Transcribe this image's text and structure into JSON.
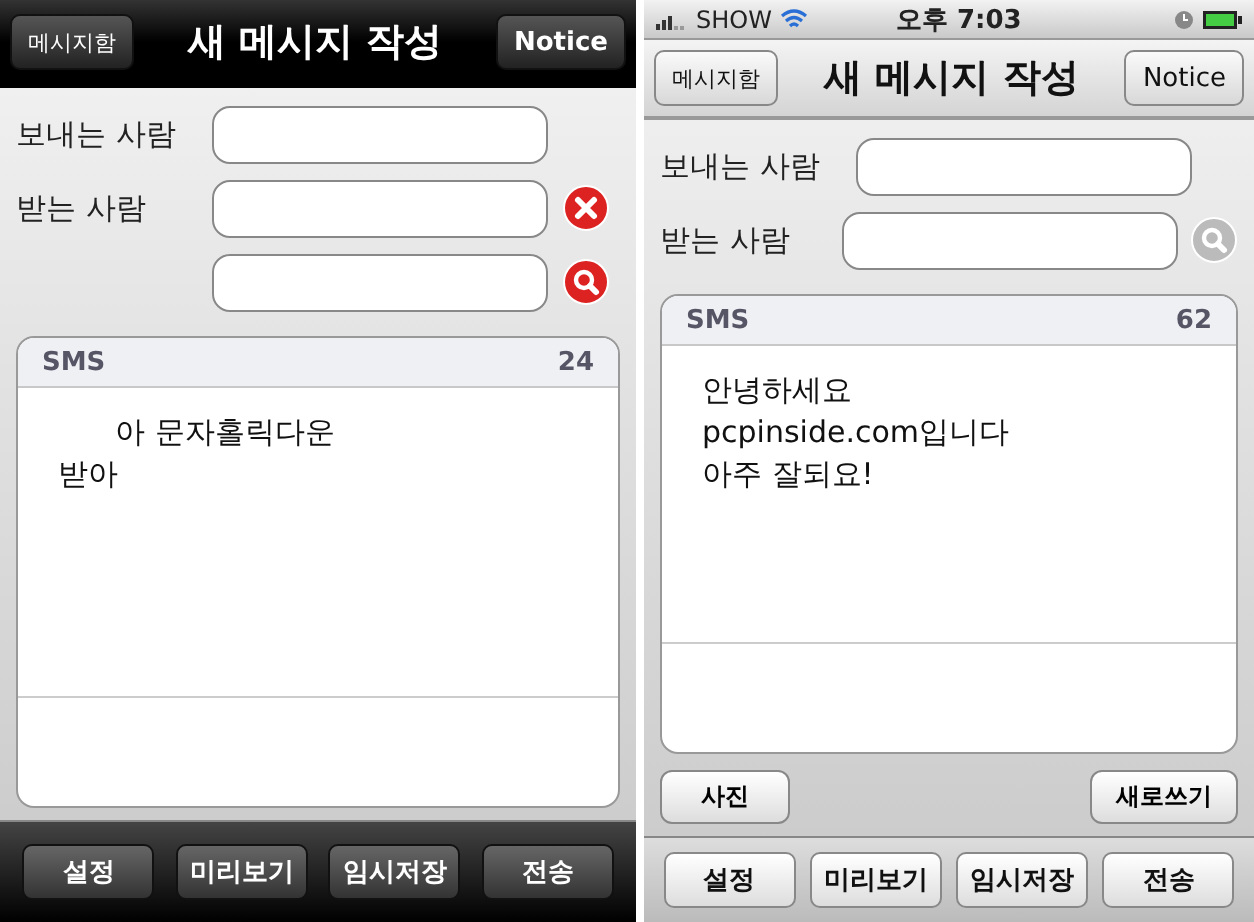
{
  "screens": [
    {
      "kind": "dark",
      "nav": {
        "back": "메시지함",
        "title": "새 메시지 작성",
        "action": "Notice"
      },
      "sender_label": "보내는 사람",
      "recipient_label": "받는 사람",
      "recipients": [
        {
          "kind": "delete",
          "active": true
        },
        {
          "kind": "search",
          "active": true
        }
      ],
      "message": {
        "type": "SMS",
        "count": "24",
        "text": "      아 문자홀릭다운\n받아"
      },
      "toolbar": [
        "설정",
        "미리보기",
        "임시저장",
        "전송"
      ]
    },
    {
      "kind": "light",
      "status_bar": {
        "carrier": "SHOW",
        "time": "오후 7:03"
      },
      "nav": {
        "back": "메시지함",
        "title": "새 메시지 작성",
        "action": "Notice"
      },
      "sender_label": "보내는 사람",
      "recipient_label": "받는 사람",
      "recipients": [
        {
          "kind": "search",
          "active": false
        }
      ],
      "message": {
        "type": "SMS",
        "count": "62",
        "text": "안녕하세요\npcpinside.com입니다\n아주 잘되요!"
      },
      "actions": [
        "사진",
        "새로쓰기"
      ],
      "toolbar": [
        "설정",
        "미리보기",
        "임시저장",
        "전송"
      ]
    }
  ]
}
